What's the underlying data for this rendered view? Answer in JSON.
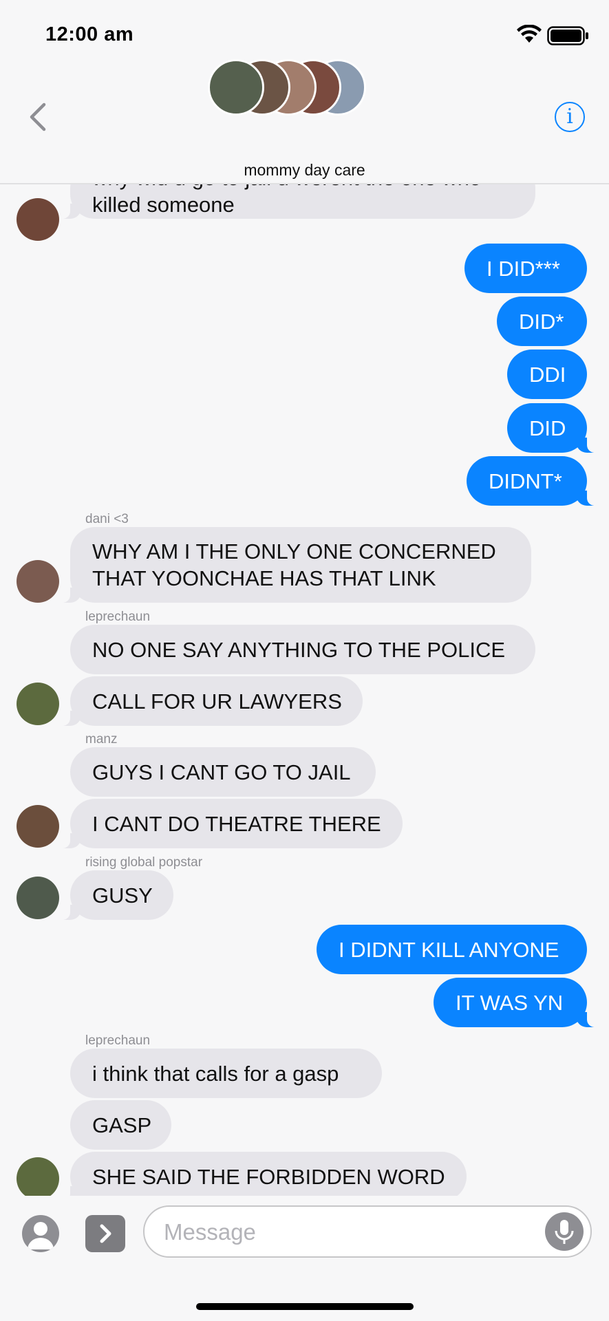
{
  "status": {
    "time": "12:00 am"
  },
  "header": {
    "title": "mommy day care"
  },
  "composer": {
    "placeholder": "Message"
  },
  "messages": [
    {
      "dir": "in",
      "text": "why wld u go to jail u werent the one who\nkilled someone"
    },
    {
      "dir": "out",
      "text": "I DID***"
    },
    {
      "dir": "out",
      "text": "DID*"
    },
    {
      "dir": "out",
      "text": "DDI"
    },
    {
      "dir": "out",
      "text": "DID"
    },
    {
      "dir": "out",
      "text": "DIDNT*"
    },
    {
      "dir": "in",
      "sender": "dani <3",
      "text": "WHY AM I THE ONLY ONE CONCERNED\nTHAT YOONCHAE HAS THAT LINK"
    },
    {
      "dir": "in",
      "sender": "leprechaun",
      "text": "NO ONE SAY ANYTHING TO THE POLICE"
    },
    {
      "dir": "in",
      "text": "CALL FOR UR LAWYERS"
    },
    {
      "dir": "in",
      "sender": "manz",
      "text": "GUYS I CANT GO TO JAIL"
    },
    {
      "dir": "in",
      "text": "I CANT DO THEATRE THERE"
    },
    {
      "dir": "in",
      "sender": "rising global popstar",
      "text": "GUSY"
    },
    {
      "dir": "out",
      "text": "I DIDNT KILL ANYONE"
    },
    {
      "dir": "out",
      "text": "IT WAS YN"
    },
    {
      "dir": "in",
      "sender": "leprechaun",
      "text": "i think that calls for a gasp"
    },
    {
      "dir": "in",
      "text": "GASP"
    },
    {
      "dir": "in",
      "text": "SHE SAID THE FORBIDDEN WORD"
    }
  ]
}
